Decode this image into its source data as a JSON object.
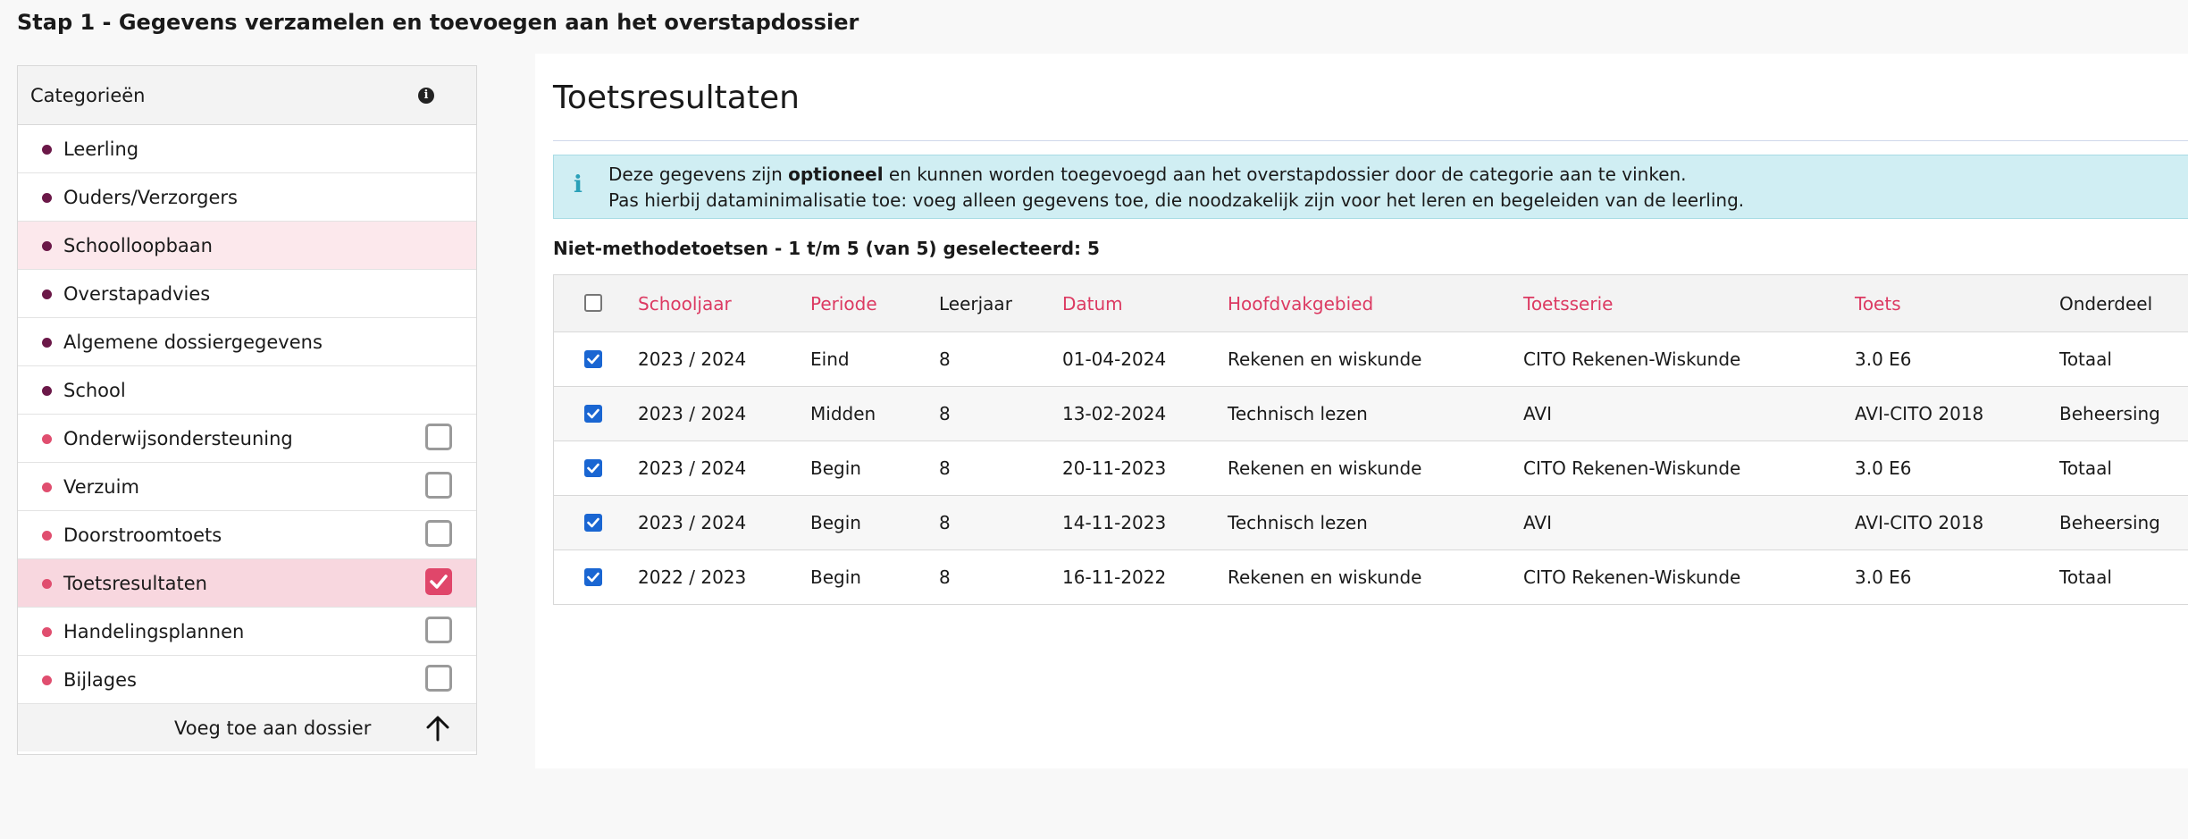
{
  "page": {
    "title": "Stap 1 - Gegevens verzamelen en toevoegen aan het overstapdossier"
  },
  "sidebar": {
    "header": "Categorieën",
    "info_icon": "info-icon",
    "items": [
      {
        "label": "Leerling",
        "dot": "dark",
        "checkbox": null,
        "state": "normal"
      },
      {
        "label": "Ouders/Verzorgers",
        "dot": "dark",
        "checkbox": null,
        "state": "normal"
      },
      {
        "label": "Schoolloopbaan",
        "dot": "dark",
        "checkbox": null,
        "state": "highlight"
      },
      {
        "label": "Overstapadvies",
        "dot": "dark",
        "checkbox": null,
        "state": "normal"
      },
      {
        "label": "Algemene dossiergegevens",
        "dot": "dark",
        "checkbox": null,
        "state": "normal"
      },
      {
        "label": "School",
        "dot": "dark",
        "checkbox": null,
        "state": "normal"
      },
      {
        "label": "Onderwijsondersteuning",
        "dot": "light",
        "checkbox": false,
        "state": "normal"
      },
      {
        "label": "Verzuim",
        "dot": "light",
        "checkbox": false,
        "state": "normal"
      },
      {
        "label": "Doorstroomtoets",
        "dot": "light",
        "checkbox": false,
        "state": "normal"
      },
      {
        "label": "Toetsresultaten",
        "dot": "light",
        "checkbox": true,
        "state": "active"
      },
      {
        "label": "Handelingsplannen",
        "dot": "light",
        "checkbox": false,
        "state": "normal"
      },
      {
        "label": "Bijlages",
        "dot": "light",
        "checkbox": false,
        "state": "normal"
      }
    ],
    "footer_button": "Voeg toe aan dossier",
    "footer_icon": "arrow-up-icon"
  },
  "main": {
    "title": "Toetsresultaten",
    "alert": {
      "icon": "info-icon",
      "line1_pre": "Deze gegevens zijn ",
      "line1_bold": "optioneel",
      "line1_post": " en kunnen worden toegevoegd aan het overstapdossier door de categorie aan te vinken.",
      "line2": "Pas hierbij dataminimalisatie toe: voeg alleen gegevens toe, die noodzakelijk zijn voor het leren en begeleiden van de leerling."
    },
    "selection_summary": "Niet-methodetoetsen - 1 t/m 5 (van 5) geselecteerd: 5",
    "table": {
      "select_all_checked": false,
      "columns": [
        {
          "label": "Schooljaar",
          "sortable": true
        },
        {
          "label": "Periode",
          "sortable": true
        },
        {
          "label": "Leerjaar",
          "sortable": false
        },
        {
          "label": "Datum",
          "sortable": true
        },
        {
          "label": "Hoofdvakgebied",
          "sortable": true
        },
        {
          "label": "Toetsserie",
          "sortable": true
        },
        {
          "label": "Toets",
          "sortable": true
        },
        {
          "label": "Onderdeel",
          "sortable": false
        }
      ],
      "rows": [
        {
          "checked": true,
          "cells": [
            "2023 / 2024",
            "Eind",
            "8",
            "01-04-2024",
            "Rekenen en wiskunde",
            "CITO Rekenen-Wiskunde",
            "3.0 E6",
            "Totaal"
          ]
        },
        {
          "checked": true,
          "cells": [
            "2023 / 2024",
            "Midden",
            "8",
            "13-02-2024",
            "Technisch lezen",
            "AVI",
            "AVI-CITO 2018",
            "Beheersing"
          ]
        },
        {
          "checked": true,
          "cells": [
            "2023 / 2024",
            "Begin",
            "8",
            "20-11-2023",
            "Rekenen en wiskunde",
            "CITO Rekenen-Wiskunde",
            "3.0 E6",
            "Totaal"
          ]
        },
        {
          "checked": true,
          "cells": [
            "2023 / 2024",
            "Begin",
            "8",
            "14-11-2023",
            "Technisch lezen",
            "AVI",
            "AVI-CITO 2018",
            "Beheersing"
          ]
        },
        {
          "checked": true,
          "cells": [
            "2022 / 2023",
            "Begin",
            "8",
            "16-11-2022",
            "Rekenen en wiskunde",
            "CITO Rekenen-Wiskunde",
            "3.0 E6",
            "Totaal"
          ]
        }
      ]
    }
  },
  "colors": {
    "accent": "#dc3a62",
    "dot_dark": "#6b1848",
    "dot_light": "#e04e6f",
    "active_row": "#f8d7df",
    "alert_bg": "#d0eef3",
    "checkbox_checked": "#1a66d2"
  }
}
